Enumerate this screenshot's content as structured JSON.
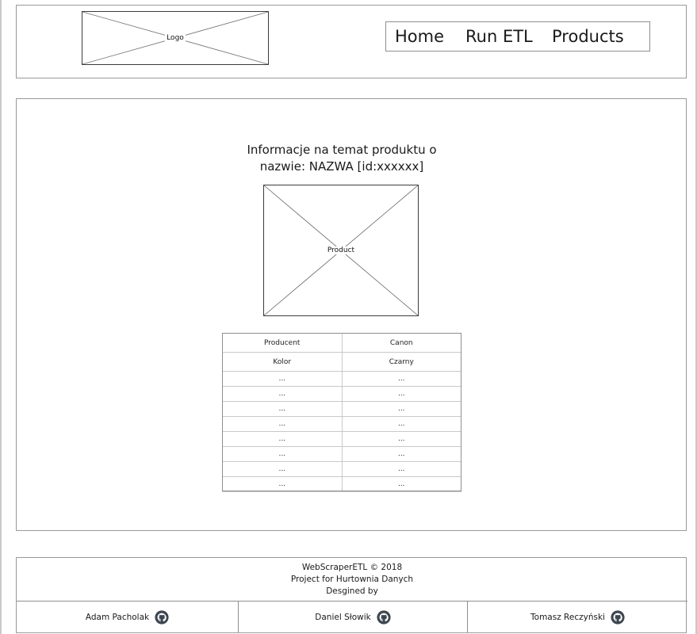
{
  "header": {
    "logo_label": "Logo",
    "nav": {
      "home": "Home",
      "run_etl": "Run ETL",
      "products": "Products"
    }
  },
  "main": {
    "title_line1": "Informacje na temat produktu o",
    "title_line2": "nazwie: NAZWA [id:xxxxxx]",
    "image_label": "Product",
    "specs": [
      [
        "Producent",
        "Canon"
      ],
      [
        "Kolor",
        "Czarny"
      ],
      [
        "...",
        "..."
      ],
      [
        "...",
        "..."
      ],
      [
        "...",
        "..."
      ],
      [
        "...",
        "..."
      ],
      [
        "...",
        "..."
      ],
      [
        "...",
        "..."
      ],
      [
        "...",
        "..."
      ],
      [
        "...",
        "..."
      ]
    ]
  },
  "footer": {
    "line1": "WebScraperETL © 2018",
    "line2": "Project for Hurtownia Danych",
    "line3": "Desgined by",
    "authors": [
      "Adam Pacholak",
      "Daniel Słowik",
      "Tomasz Reczyński"
    ],
    "author_icon": "github-icon"
  }
}
